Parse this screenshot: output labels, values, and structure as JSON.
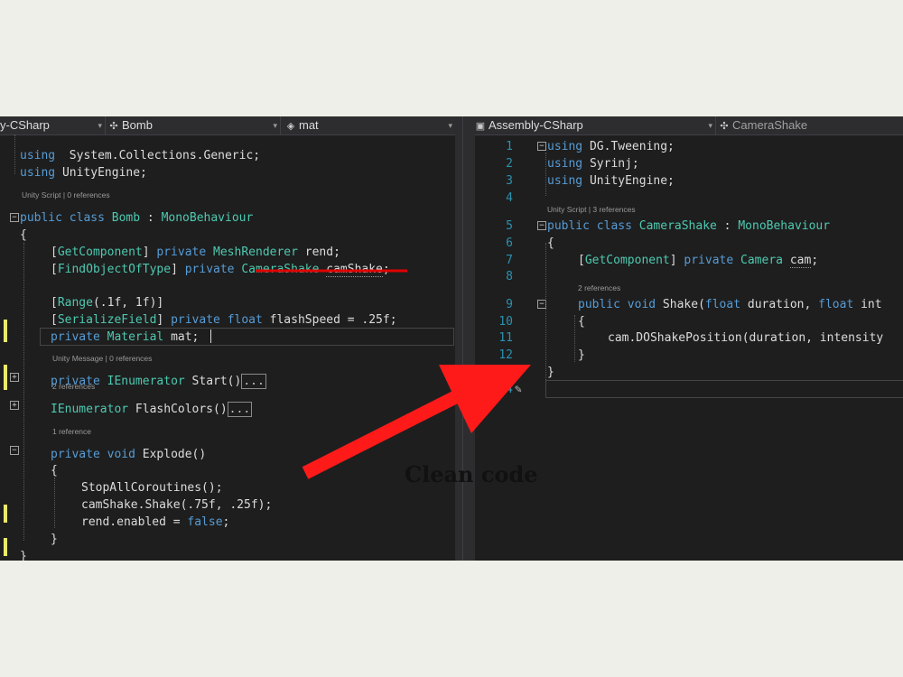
{
  "left_editor": {
    "nav": {
      "project": "y-CSharp",
      "class": "Bomb",
      "member": "mat"
    },
    "code_lens": {
      "class_refs": "Unity Script | 0 references",
      "start_refs": "Unity Message | 0 references",
      "flash_refs": "2 references",
      "explode_refs": "1 reference"
    },
    "lines": [
      {
        "segs": [
          [
            "kw",
            "using"
          ],
          [
            "",
            "  System.Collections.Generic;"
          ]
        ]
      },
      {
        "segs": [
          [
            "kw",
            "using"
          ],
          [
            "",
            " UnityEngine;"
          ]
        ]
      },
      {
        "segs": [
          [
            "kw",
            "public"
          ],
          [
            "",
            " "
          ],
          [
            "kw",
            "class"
          ],
          [
            "",
            " "
          ],
          [
            "ty",
            "Bomb"
          ],
          [
            "",
            " : "
          ],
          [
            "ty",
            "MonoBehaviour"
          ]
        ]
      },
      {
        "segs": [
          [
            "",
            "{"
          ]
        ]
      },
      {
        "segs": [
          [
            "",
            "["
          ],
          [
            "ty",
            "GetComponent"
          ],
          [
            "",
            "] "
          ],
          [
            "kw",
            "private"
          ],
          [
            "",
            " "
          ],
          [
            "ty",
            "MeshRenderer"
          ],
          [
            "",
            " rend;"
          ]
        ]
      },
      {
        "segs": [
          [
            "",
            "["
          ],
          [
            "ty",
            "FindObjectOfType"
          ],
          [
            "",
            "] "
          ],
          [
            "kw",
            "private"
          ],
          [
            "",
            " "
          ],
          [
            "ty",
            "CameraShake"
          ],
          [
            "",
            " "
          ],
          [
            "sq",
            "camShake"
          ],
          [
            "",
            ";"
          ]
        ]
      },
      {
        "segs": [
          [
            "",
            "["
          ],
          [
            "ty",
            "Range"
          ],
          [
            "",
            "(.1f, 1f)]"
          ]
        ]
      },
      {
        "segs": [
          [
            "",
            "["
          ],
          [
            "ty",
            "SerializeField"
          ],
          [
            "",
            "] "
          ],
          [
            "kw",
            "private"
          ],
          [
            "",
            " "
          ],
          [
            "kw",
            "float"
          ],
          [
            "",
            " flashSpeed = .25f;"
          ]
        ]
      },
      {
        "segs": [
          [
            "kw",
            "private"
          ],
          [
            "",
            " "
          ],
          [
            "ty",
            "Material"
          ],
          [
            "",
            " mat;"
          ]
        ]
      },
      {
        "segs": [
          [
            "kw",
            "private"
          ],
          [
            "",
            " "
          ],
          [
            "ty",
            "IEnumerator"
          ],
          [
            "",
            " Start()"
          ],
          [
            "el",
            "..."
          ]
        ]
      },
      {
        "segs": [
          [
            "ty",
            "IEnumerator"
          ],
          [
            "",
            " FlashColors()"
          ],
          [
            "el",
            "..."
          ]
        ]
      },
      {
        "segs": [
          [
            "kw",
            "private"
          ],
          [
            "",
            " "
          ],
          [
            "kw",
            "void"
          ],
          [
            "",
            " Explode()"
          ]
        ]
      },
      {
        "segs": [
          [
            "",
            "{"
          ]
        ]
      },
      {
        "segs": [
          [
            "",
            "StopAllCoroutines();"
          ]
        ]
      },
      {
        "segs": [
          [
            "",
            "camShake.Shake(.75f, .25f);"
          ]
        ]
      },
      {
        "segs": [
          [
            "",
            "rend.enabled = "
          ],
          [
            "kw",
            "false"
          ],
          [
            "",
            ";"
          ]
        ]
      },
      {
        "segs": [
          [
            "",
            "}"
          ]
        ]
      },
      {
        "segs": [
          [
            "",
            "}"
          ]
        ]
      }
    ]
  },
  "right_editor": {
    "nav": {
      "project": "Assembly-CSharp",
      "class": "CameraShake"
    },
    "code_lens": {
      "class_refs": "Unity Script | 3 references",
      "shake_refs": "2 references"
    },
    "line_numbers": [
      "1",
      "2",
      "3",
      "4",
      "5",
      "6",
      "7",
      "8",
      "9",
      "10",
      "11",
      "12",
      "13",
      "14"
    ],
    "lines": [
      {
        "segs": [
          [
            "kw",
            "using"
          ],
          [
            "",
            " DG.Tweening;"
          ]
        ]
      },
      {
        "segs": [
          [
            "kw",
            "using"
          ],
          [
            "",
            " Syrinj;"
          ]
        ]
      },
      {
        "segs": [
          [
            "kw",
            "using"
          ],
          [
            "",
            " UnityEngine;"
          ]
        ]
      },
      {
        "segs": []
      },
      {
        "segs": [
          [
            "kw",
            "public"
          ],
          [
            "",
            " "
          ],
          [
            "kw",
            "class"
          ],
          [
            "",
            " "
          ],
          [
            "ty",
            "CameraShake"
          ],
          [
            "",
            " : "
          ],
          [
            "ty",
            "MonoBehaviour"
          ]
        ]
      },
      {
        "segs": [
          [
            "",
            "{"
          ]
        ]
      },
      {
        "segs": [
          [
            "",
            "["
          ],
          [
            "ty",
            "GetComponent"
          ],
          [
            "",
            "] "
          ],
          [
            "kw",
            "private"
          ],
          [
            "",
            " "
          ],
          [
            "ty",
            "Camera"
          ],
          [
            "",
            " "
          ],
          [
            "sq",
            "cam"
          ],
          [
            "",
            ";"
          ]
        ]
      },
      {
        "segs": []
      },
      {
        "segs": [
          [
            "kw",
            "public"
          ],
          [
            "",
            " "
          ],
          [
            "kw",
            "void"
          ],
          [
            "",
            " Shake("
          ],
          [
            "kw",
            "float"
          ],
          [
            "",
            " duration, "
          ],
          [
            "kw",
            "float"
          ],
          [
            "",
            " int"
          ]
        ]
      },
      {
        "segs": [
          [
            "",
            "{"
          ]
        ]
      },
      {
        "segs": [
          [
            "",
            "cam.DOShakePosition(duration, intensity"
          ]
        ]
      },
      {
        "segs": [
          [
            "",
            "}"
          ]
        ]
      },
      {
        "segs": [
          [
            "",
            "}"
          ]
        ]
      },
      {
        "segs": []
      }
    ]
  },
  "annotation": {
    "text": "Clean code",
    "arrow_color": "#ff1a1a",
    "underline_color": "#e00000"
  }
}
